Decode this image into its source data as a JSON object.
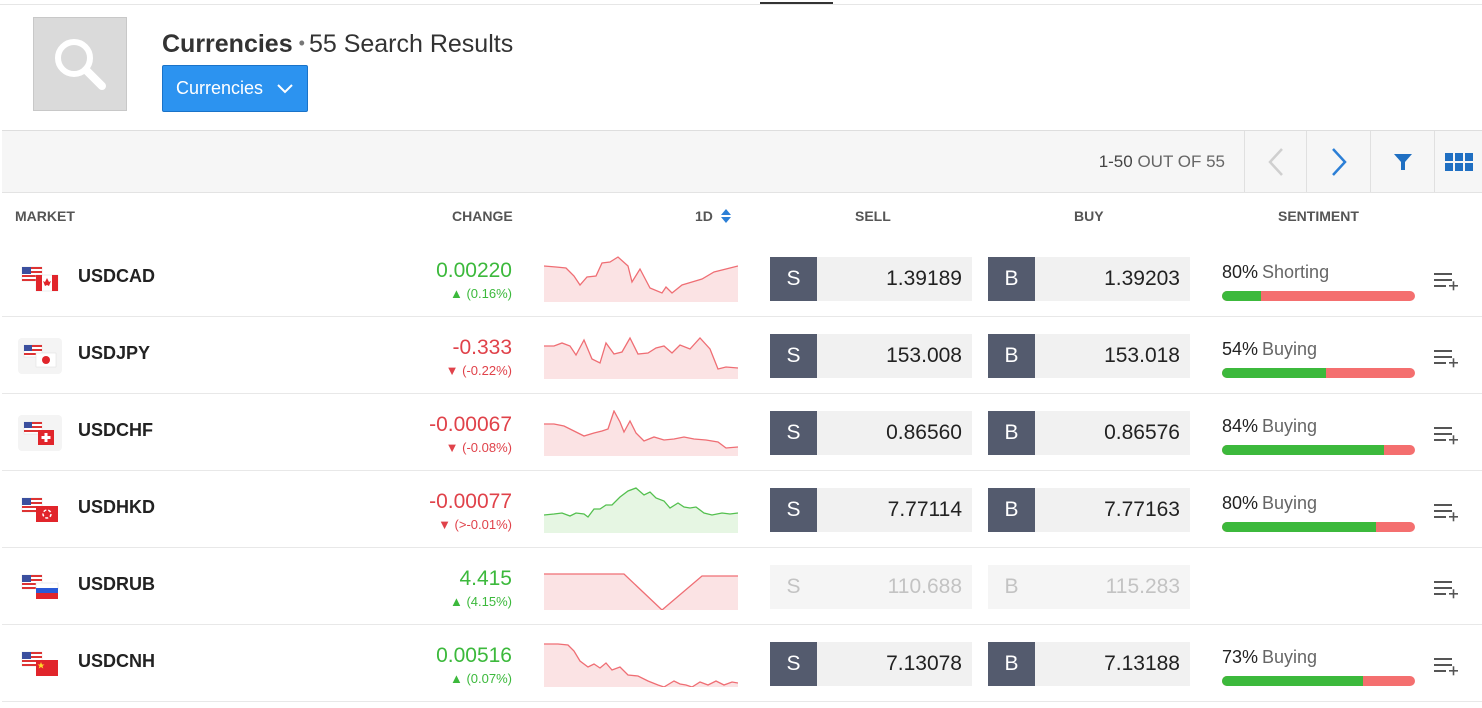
{
  "header": {
    "title": "Currencies",
    "separator": "•",
    "results": "55 Search Results",
    "dropdown_label": "Currencies"
  },
  "toolbar": {
    "range": "1-50",
    "out_of": "OUT OF 55"
  },
  "columns": {
    "market": "MARKET",
    "change": "CHANGE",
    "period": "1D",
    "sell": "SELL",
    "buy": "BUY",
    "sentiment": "SENTIMENT"
  },
  "rows": [
    {
      "symbol": "USDCAD",
      "change": "0.00220",
      "change_pct": "(0.16%)",
      "direction": "up",
      "sell_letter": "S",
      "sell": "1.39189",
      "buy_letter": "B",
      "buy": "1.39203",
      "sentiment_pct": "80%",
      "sentiment_word": "Shorting",
      "buying_fraction": 0.2,
      "tradable": true
    },
    {
      "symbol": "USDJPY",
      "change": "-0.333",
      "change_pct": "(-0.22%)",
      "direction": "down",
      "sell_letter": "S",
      "sell": "153.008",
      "buy_letter": "B",
      "buy": "153.018",
      "sentiment_pct": "54%",
      "sentiment_word": "Buying",
      "buying_fraction": 0.54,
      "tradable": true
    },
    {
      "symbol": "USDCHF",
      "change": "-0.00067",
      "change_pct": "(-0.08%)",
      "direction": "down",
      "sell_letter": "S",
      "sell": "0.86560",
      "buy_letter": "B",
      "buy": "0.86576",
      "sentiment_pct": "84%",
      "sentiment_word": "Buying",
      "buying_fraction": 0.84,
      "tradable": true
    },
    {
      "symbol": "USDHKD",
      "change": "-0.00077",
      "change_pct": "(>-0.01%)",
      "direction": "down",
      "sell_letter": "S",
      "sell": "7.77114",
      "buy_letter": "B",
      "buy": "7.77163",
      "sentiment_pct": "80%",
      "sentiment_word": "Buying",
      "buying_fraction": 0.8,
      "tradable": true
    },
    {
      "symbol": "USDRUB",
      "change": "4.415",
      "change_pct": "(4.15%)",
      "direction": "up",
      "sell_letter": "S",
      "sell": "110.688",
      "buy_letter": "B",
      "buy": "115.283",
      "sentiment_pct": "",
      "sentiment_word": "",
      "buying_fraction": null,
      "tradable": false
    },
    {
      "symbol": "USDCNH",
      "change": "0.00516",
      "change_pct": "(0.07%)",
      "direction": "up",
      "sell_letter": "S",
      "sell": "7.13078",
      "buy_letter": "B",
      "buy": "7.13188",
      "sentiment_pct": "73%",
      "sentiment_word": "Buying",
      "buying_fraction": 0.73,
      "tradable": true
    }
  ],
  "icons": {
    "search": "search-icon",
    "dropdown": "chevron-down-icon",
    "prev": "chevron-left-icon",
    "next": "chevron-right-icon",
    "filter": "filter-icon",
    "grid": "grid-view-icon",
    "row_menu": "add-to-list-icon",
    "sort": "sort-icon"
  },
  "colors": {
    "accent": "#2c93f0",
    "up": "#3cb93c",
    "down": "#e0424a",
    "trade_button": "#545b6e",
    "sentiment_short": "#f46f6f"
  }
}
